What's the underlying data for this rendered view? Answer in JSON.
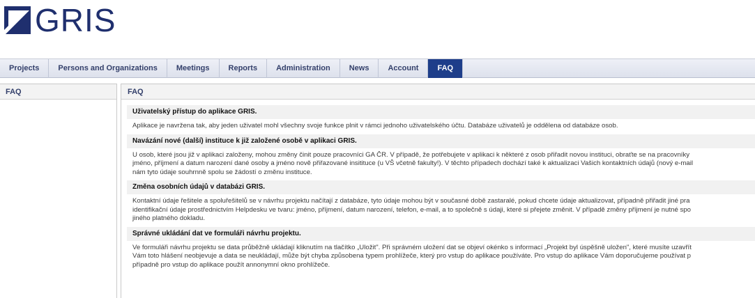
{
  "app": {
    "logo_text": "GRIS"
  },
  "nav": {
    "tabs": [
      {
        "label": "Projects",
        "active": false
      },
      {
        "label": "Persons and Organizations",
        "active": false
      },
      {
        "label": "Meetings",
        "active": false
      },
      {
        "label": "Reports",
        "active": false
      },
      {
        "label": "Administration",
        "active": false
      },
      {
        "label": "News",
        "active": false
      },
      {
        "label": "Account",
        "active": false
      },
      {
        "label": "FAQ",
        "active": true
      }
    ]
  },
  "sidebar": {
    "title": "FAQ"
  },
  "main": {
    "title": "FAQ",
    "faq": [
      {
        "question": "Uživatelský přístup do aplikace GRIS.",
        "answer_lines": [
          "Aplikace je navržena tak, aby jeden uživatel mohl všechny svoje funkce plnit v rámci jednoho uživatelského účtu. Databáze uživatelů je oddělena od databáze osob."
        ]
      },
      {
        "question": "Navázání nové (další) instituce k již založené osobě v aplikaci GRIS.",
        "answer_lines": [
          "U osob, které jsou již v aplikaci založeny, mohou změny činit pouze pracovníci GA ČR. V případě, že potřebujete v aplikaci k některé z osob přiřadit novou instituci, obraťte se na pracovníky",
          "jméno, příjmení a datum narození dané osoby a jméno nově přiřazované insititucе (u VŠ včetně fakulty!). V těchto případech dochází také k aktualizaci Vašich kontaktních údajů (nový e-mail",
          "nám tyto údaje souhrnně spolu se žádostí o změnu instituce."
        ]
      },
      {
        "question": "Změna osobních údajů v databázi GRIS.",
        "answer_lines": [
          "Kontaktní údaje řešitele a spoluřešitelů se v návrhu projektu načítají z databáze, tyto údaje mohou být v současné době zastaralé, pokud chcete údaje aktualizovat, případně přiřadit jiné pra",
          "identifikační údaje prostřednictvím Helpdesku ve tvaru: jméno, příjmení, datum narození, telefon, e-mail, a to společně s údaji, které si přejete změnit. V případě změny příjmení je nutné spo",
          "jiného platného dokladu."
        ]
      },
      {
        "question": "Správné ukládání dat ve formuláři návrhu projektu.",
        "answer_lines": [
          "Ve formuláři návrhu projektu se data průběžně ukládají kliknutím na tlačítko „Uložit\". Při správném uložení dat se objeví okénko s informací „Projekt byl úspěšně uložen\", které musíte uzavřít",
          "Vám toto hlášení neobjevuje a data se neukládají, může být chyba způsobena typem prohlížeče, který pro vstup do aplikace používáte. Pro vstup do aplikace Vám doporučujeme používat p",
          "případně pro vstup do aplikace použít annonymní okno prohlížeče."
        ]
      }
    ]
  }
}
